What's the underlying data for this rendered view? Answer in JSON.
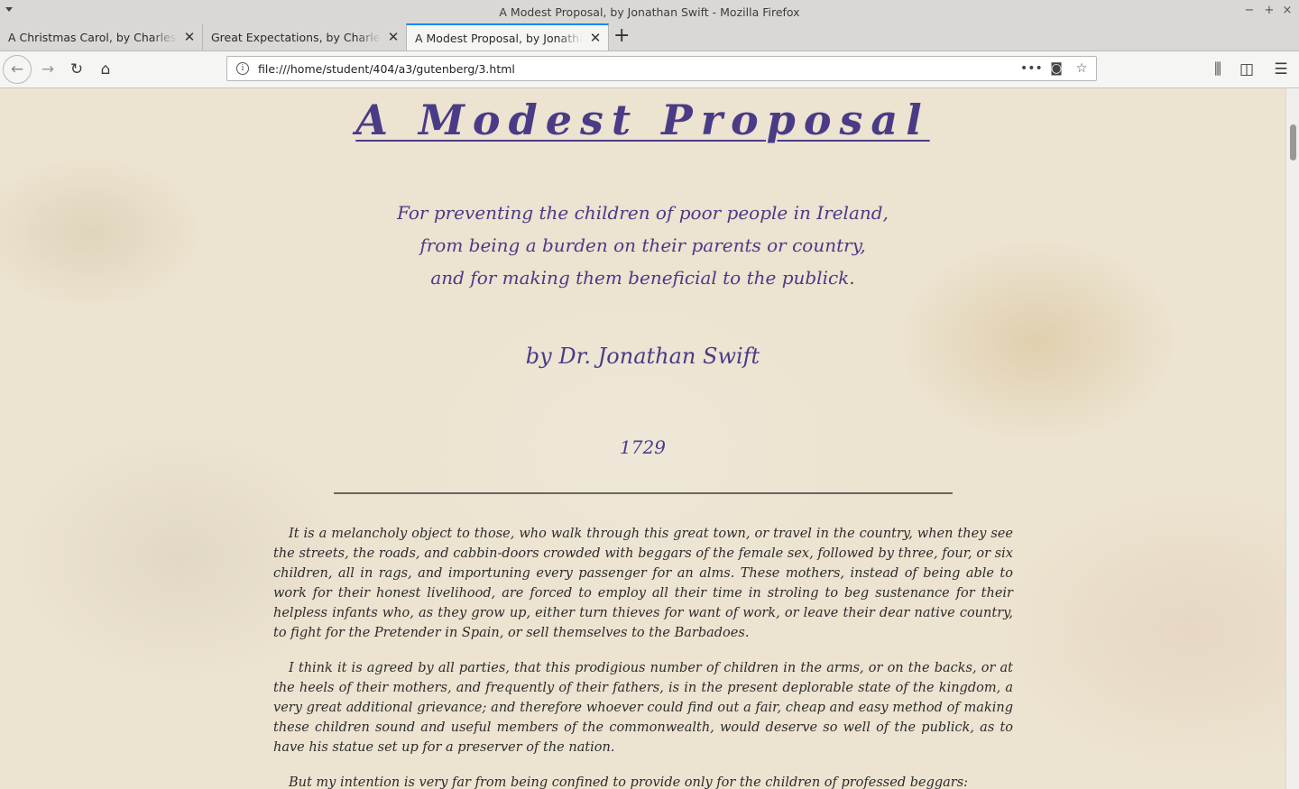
{
  "window": {
    "title": "A Modest Proposal, by Jonathan Swift - Mozilla Firefox"
  },
  "tabs": [
    {
      "label": "A Christmas Carol, by Charles Dickens"
    },
    {
      "label": "Great Expectations, by Charles Dickens"
    },
    {
      "label": "A Modest Proposal, by Jonathan Swift"
    }
  ],
  "nav": {
    "url": "file:///home/student/404/a3/gutenberg/3.html"
  },
  "document": {
    "title": "A Modest Proposal",
    "subtitle_lines": [
      "For preventing the children of poor people in Ireland,",
      "from being a burden on their parents or country,",
      "and for making them beneficial to the publick."
    ],
    "author": "by Dr. Jonathan Swift",
    "year": "1729",
    "paragraphs": [
      "It is a melancholy object to those, who walk through this great town, or travel in the country, when they see the streets, the roads, and cabbin-doors crowded with beggars of the female sex, followed by three, four, or six children, all in rags, and importuning every passenger for an alms. These mothers, instead of being able to work for their honest livelihood, are forced to employ all their time in stroling to beg sustenance for their helpless infants who, as they grow up, either turn thieves for want of work, or leave their dear native country, to fight for the Pretender in Spain, or sell themselves to the Barbadoes.",
      "I think it is agreed by all parties, that this prodigious number of children in the arms, or on the backs, or at the heels of their mothers, and frequently of their fathers, is in the present deplorable state of the kingdom, a very great additional grievance; and therefore whoever could find out a fair, cheap and easy method of making these children sound and useful members of the commonwealth, would deserve so well of the publick, as to have his statue set up for a preserver of the nation.",
      "But my intention is very far from being confined to provide only for the children of professed beggars:"
    ]
  },
  "colors": {
    "heading": "#4a3b87",
    "tab_accent": "#0a84ff"
  }
}
